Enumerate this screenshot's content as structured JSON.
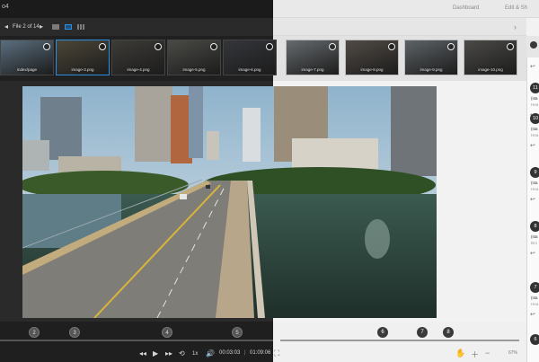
{
  "app": {
    "name": "o4"
  },
  "nav": {
    "dashboard": "Dashboard",
    "edit": "Edit & Sh"
  },
  "file_nav": {
    "prev_icon": "triangle-left-icon",
    "label": "File 2 of 14",
    "next_icon": "triangle-right-icon"
  },
  "filmstrip": [
    {
      "label": "index/page",
      "tone": "#5a6e7e"
    },
    {
      "label": "image-3.png",
      "tone": "#4c4638"
    },
    {
      "label": "image-4.png",
      "tone": "#3d3b37"
    },
    {
      "label": "image-5.png",
      "tone": "#4a4b46"
    },
    {
      "label": "image-6.png",
      "tone": "#34363a"
    },
    {
      "label": "image-7.png",
      "tone": "#666b6e"
    },
    {
      "label": "image-8.png",
      "tone": "#514b45"
    },
    {
      "label": "image-9.png",
      "tone": "#5d6366"
    },
    {
      "label": "image-10.png",
      "tone": "#4b4a47"
    }
  ],
  "timeline": {
    "markers_dark": [
      "2",
      "3",
      "4",
      "5"
    ],
    "markers_light": [
      "6",
      "7",
      "8"
    ],
    "current_time": "00:03:03",
    "total_time": "01:09:06",
    "zoom": "67%"
  },
  "sidebar": {
    "comments": [
      {
        "num": "11",
        "line1": "(sta",
        "line2": "Hea"
      },
      {
        "num": "10",
        "line1": "(sta",
        "line2": "Hea"
      },
      {
        "num": "9",
        "line1": "(sta",
        "line2": "Hea"
      },
      {
        "num": "8",
        "line1": "(sta",
        "line2": "Bro"
      },
      {
        "num": "7",
        "line1": "(sta",
        "line2": "Hea"
      },
      {
        "num": "6",
        "line1": "",
        "line2": ""
      }
    ]
  }
}
